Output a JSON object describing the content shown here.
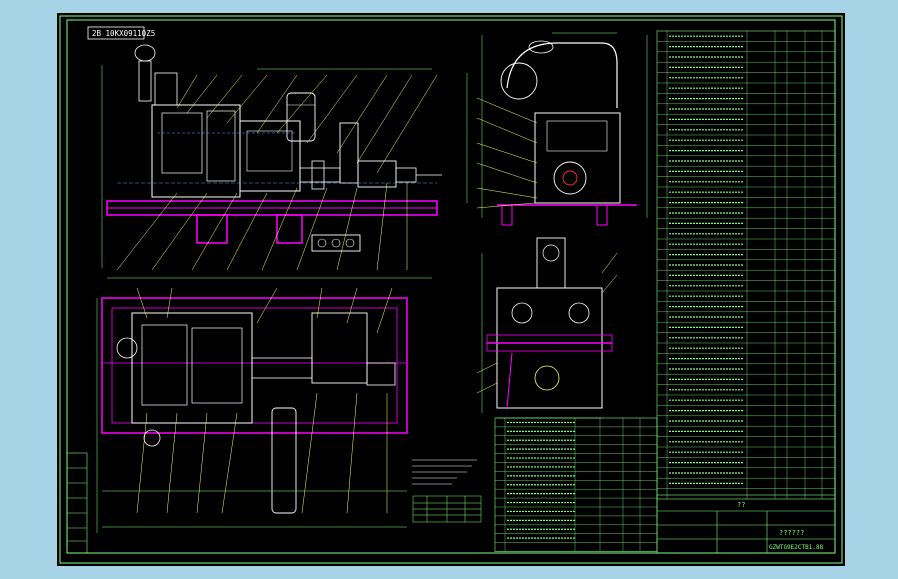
{
  "drawing": {
    "code": "2B 10KX09110Z5",
    "title_block": {
      "doc_name": "??????",
      "mark": "??",
      "drawing_no": "GZWTG9E2CTB1.88"
    },
    "bom_rows": 45,
    "bom_lower_rows": 15
  },
  "colors": {
    "page_bg": "#a6d4e6",
    "sheet_bg": "#000000",
    "frame": "#7fff7f",
    "outline": "#ffffff",
    "base": "#ff00ff",
    "hidden": "#5aa0ff",
    "leader": "#ffff66",
    "accent": "#ff3030"
  },
  "icons": {
    "engine_front_view": "engine-side-elevation-icon",
    "engine_plan_view": "engine-plan-view-icon",
    "engine_end_view": "engine-end-elevation-icon",
    "pump_view": "pump-assembly-icon"
  }
}
